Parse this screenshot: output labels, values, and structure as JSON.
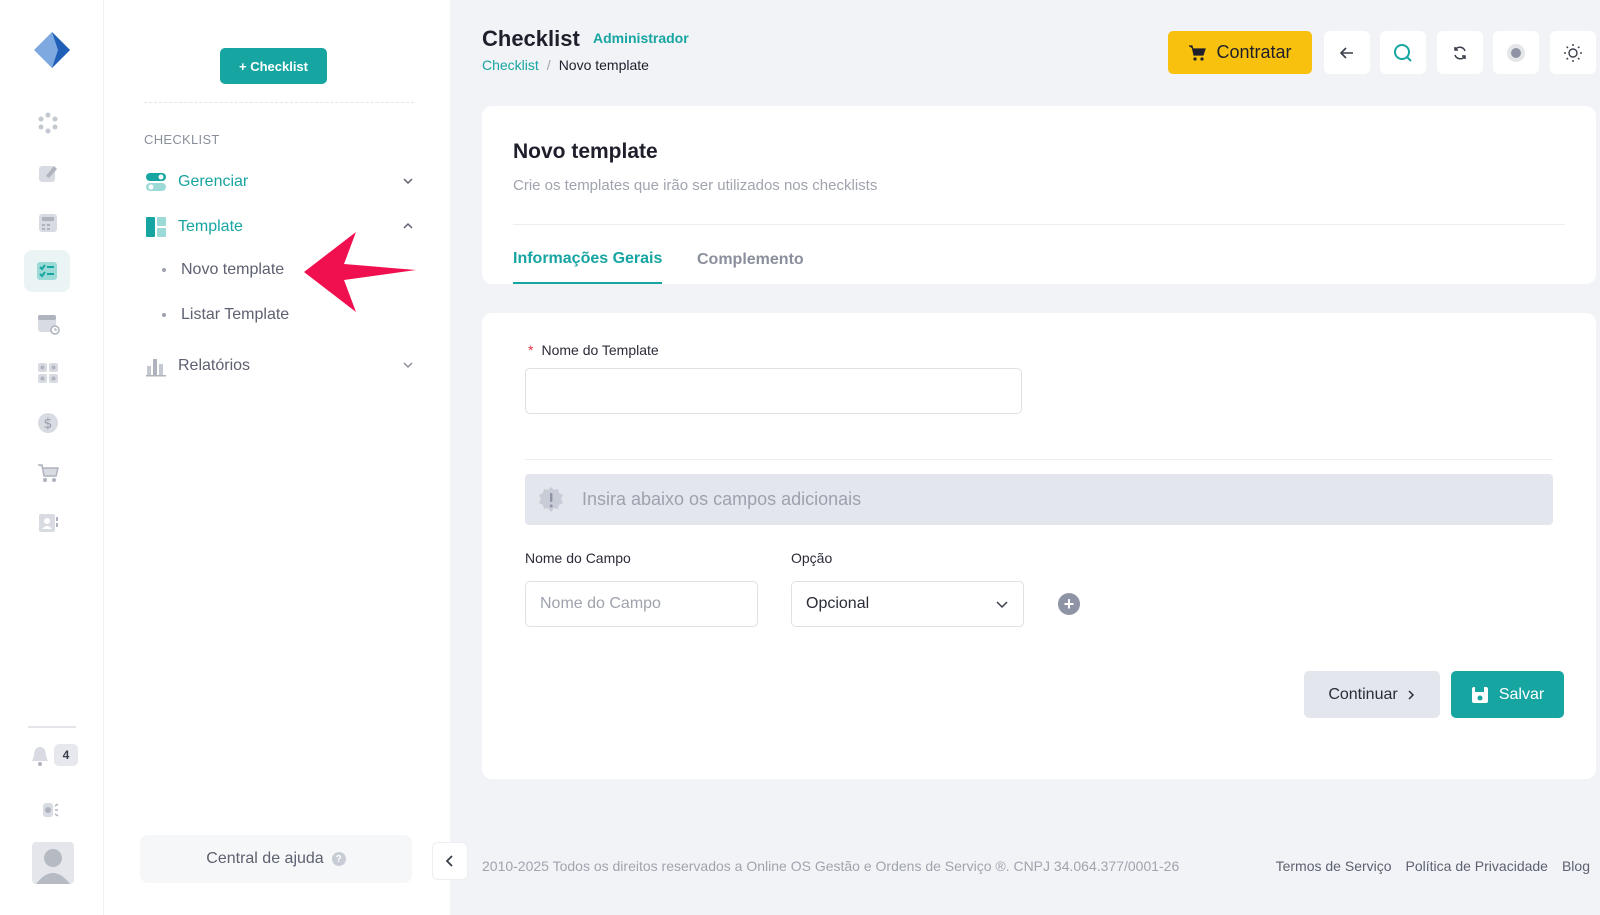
{
  "rail": {
    "notification_count": "4"
  },
  "sidebar": {
    "new_button": "+ Checklist",
    "section_title": "CHECKLIST",
    "items": [
      {
        "label": "Gerenciar"
      },
      {
        "label": "Template"
      },
      {
        "label": "Relatórios"
      }
    ],
    "template_sub": [
      {
        "label": "Novo template"
      },
      {
        "label": "Listar Template"
      }
    ],
    "help_label": "Central de ajuda",
    "help_badge": "?"
  },
  "header": {
    "title": "Checklist",
    "role": "Administrador",
    "breadcrumb": {
      "root": "Checklist",
      "sep": "/",
      "current": "Novo template"
    },
    "contratar_label": "Contratar"
  },
  "card": {
    "title": "Novo template",
    "subtitle": "Crie os templates que irão ser utilizados nos checklists",
    "tabs": [
      {
        "label": "Informações Gerais",
        "active": true
      },
      {
        "label": "Complemento",
        "active": false
      }
    ]
  },
  "form": {
    "required_mark": "*",
    "template_name_label": "Nome do Template",
    "template_name_value": "",
    "alert_text": "Insira abaixo os campos adicionais",
    "field_name_label": "Nome do Campo",
    "field_name_placeholder": "Nome do Campo",
    "option_label": "Opção",
    "option_value": "Opcional",
    "add_symbol": "+",
    "continue_label": "Continuar",
    "save_label": "Salvar"
  },
  "footer": {
    "copyright": "2010-2025 Todos os direitos reservados a Online OS Gestão e Ordens de Serviço ®. CNPJ 34.064.377/0001-26",
    "links": [
      "Termos de Serviço",
      "Política de Privacidade",
      "Blog"
    ]
  },
  "colors": {
    "accent": "#17a5a2",
    "warning": "#f8c10e",
    "annotation": "#f0104f"
  }
}
